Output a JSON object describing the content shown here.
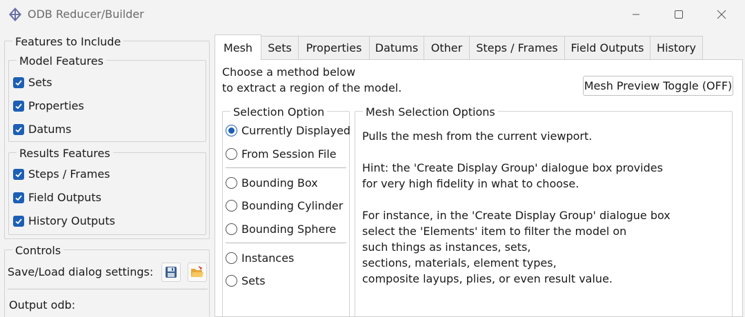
{
  "window": {
    "title": "ODB Reducer/Builder",
    "icon": "abaqus-logo-icon",
    "controls": [
      "minimize",
      "maximize",
      "close"
    ]
  },
  "features": {
    "title": "Features to Include",
    "model": {
      "title": "Model Features",
      "items": [
        {
          "label": "Sets",
          "checked": true
        },
        {
          "label": "Properties",
          "checked": true
        },
        {
          "label": "Datums",
          "checked": true
        }
      ]
    },
    "results": {
      "title": "Results Features",
      "items": [
        {
          "label": "Steps / Frames",
          "checked": true
        },
        {
          "label": "Field Outputs",
          "checked": true
        },
        {
          "label": "History Outputs",
          "checked": true
        }
      ]
    }
  },
  "controls": {
    "title": "Controls",
    "save_load_label": "Save/Load dialog settings:",
    "save_icon": "floppy-save-icon",
    "load_icon": "folder-open-icon",
    "output_label": "Output odb:"
  },
  "tabs": [
    "Mesh",
    "Sets",
    "Properties",
    "Datums",
    "Other",
    "Steps / Frames",
    "Field Outputs",
    "History"
  ],
  "active_tab": "Mesh",
  "mesh": {
    "intro_line1": "Choose a method below",
    "intro_line2": "to extract a region of the model.",
    "preview_button": "Mesh Preview Toggle (OFF)",
    "selection": {
      "title": "Selection Option",
      "options": [
        "Currently Displayed",
        "From Session File",
        "Bounding Box",
        "Bounding Cylinder",
        "Bounding Sphere",
        "Instances",
        "Sets"
      ],
      "selected": "Currently Displayed"
    },
    "options_panel": {
      "title": "Mesh Selection Options",
      "lines": [
        "Pulls the mesh from the current viewport.",
        "",
        "Hint: the 'Create Display Group' dialogue box provides",
        "for very high fidelity in what to choose.",
        "",
        "For instance, in the 'Create Display Group' dialogue box",
        "select the 'Elements' item to filter the model on",
        "such things as instances, sets,",
        "sections, materials, element types,",
        "composite layups, plies, or even result value."
      ]
    }
  },
  "colors": {
    "accent": "#1d5fb4",
    "window_bg": "#f3f3f3",
    "panel_bg": "#ffffff"
  }
}
